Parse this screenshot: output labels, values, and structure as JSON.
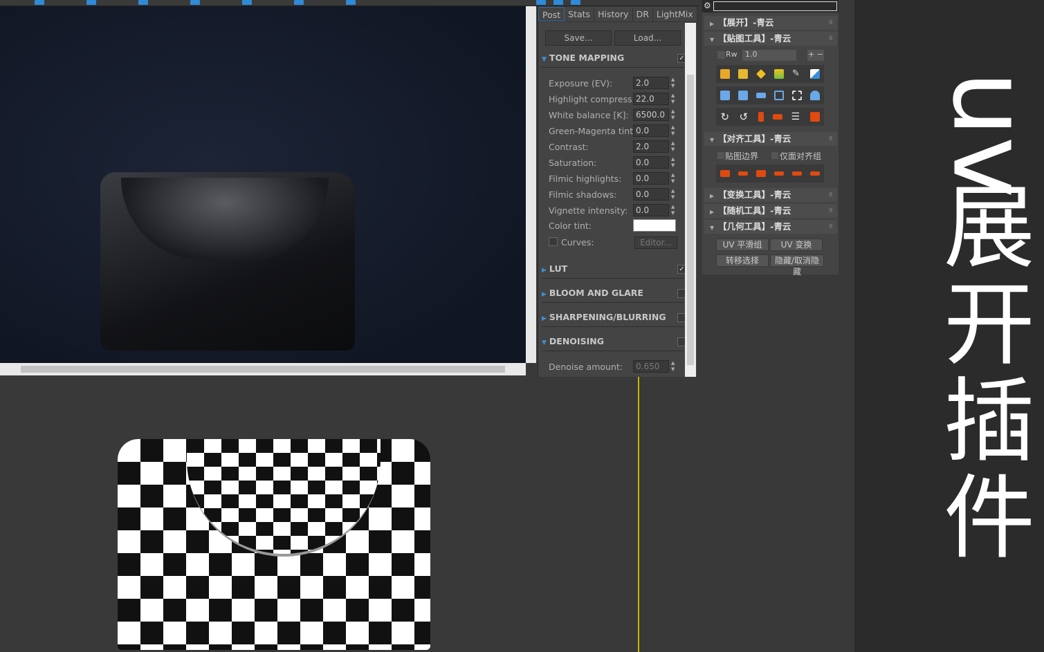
{
  "vfb": {
    "tabs": [
      "Post",
      "Stats",
      "History",
      "DR",
      "LightMix"
    ],
    "save": "Save...",
    "load": "Load...",
    "tone_mapping": {
      "title": "TONE MAPPING",
      "checked": true,
      "rows": [
        {
          "label": "Exposure (EV):",
          "value": "2.0"
        },
        {
          "label": "Highlight compress:",
          "value": "22.0"
        },
        {
          "label": "White balance [K]:",
          "value": "6500.0"
        },
        {
          "label": "Green-Magenta tint:",
          "value": "0.0"
        },
        {
          "label": "Contrast:",
          "value": "2.0"
        },
        {
          "label": "Saturation:",
          "value": "0.0"
        },
        {
          "label": "Filmic highlights:",
          "value": "0.0"
        },
        {
          "label": "Filmic shadows:",
          "value": "0.0"
        },
        {
          "label": "Vignette intensity:",
          "value": "0.0"
        }
      ],
      "color_tint": "Color tint:",
      "color_tint_value": "#ffffff",
      "curves": "Curves:",
      "editor": "Editor..."
    },
    "sections": [
      {
        "title": "LUT",
        "checked": true
      },
      {
        "title": "BLOOM AND GLARE",
        "checked": false
      },
      {
        "title": "SHARPENING/BLURRING",
        "checked": false
      },
      {
        "title": "DENOISING",
        "checked": false
      }
    ],
    "denoise_label": "Denoise amount:",
    "denoise_value": "0.650"
  },
  "rollout": {
    "unwrap": "【展开】-青云",
    "map_tools": "【贴图工具】-青云",
    "rw_label": "Rw",
    "rw_value": "1.0",
    "plus_minus": "+ −",
    "align_tools": "【对齐工具】-青云",
    "map_border": "贴图边界",
    "face_align": "仅面对齐组",
    "transform_tools": "【变换工具】-青云",
    "random_tools": "【随机工具】-青云",
    "geometry_tools": "【几何工具】-青云",
    "uv_smooth": "UV 平滑组",
    "uv_transform": "UV 变换",
    "transfer_select": "转移选择",
    "hide_unhide": "隐藏/取消隐藏"
  },
  "title": {
    "uv": "uv",
    "rest": [
      "展",
      "开",
      "插",
      "件"
    ]
  }
}
